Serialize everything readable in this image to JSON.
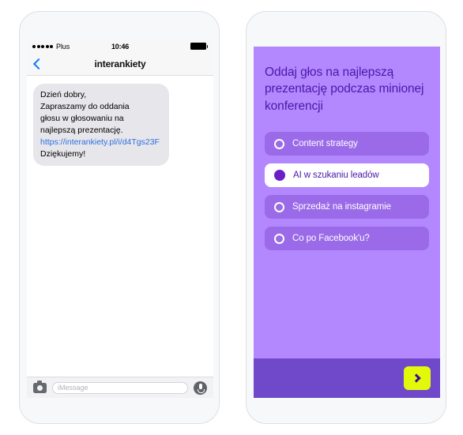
{
  "left_phone": {
    "status_bar": {
      "signal_dots": 5,
      "carrier": "Plus",
      "time": "10:46",
      "battery_icon": "battery-full-icon"
    },
    "nav_bar": {
      "back_icon": "chevron-left-icon",
      "title": "interankiety"
    },
    "message": {
      "line1": "Dzień dobry,",
      "line2": "Zapraszamy do oddania",
      "line3": "głosu w głosowaniu na",
      "line4": "najlepszą prezentację.",
      "link": "https://interankiety.pl/i/d4Tgs23F",
      "line5": "Dziękujemy!"
    },
    "input_bar": {
      "camera_icon": "camera-icon",
      "placeholder": "iMessage",
      "mic_icon": "microphone-icon"
    }
  },
  "right_phone": {
    "poll": {
      "heading": "Oddaj głos na najlepszą prezentację podczas minionej konferencji",
      "options": [
        {
          "label": "Content strategy",
          "selected": false
        },
        {
          "label": "AI w szukaniu leadów",
          "selected": true
        },
        {
          "label": "Sprzedaż na instagramie",
          "selected": false
        },
        {
          "label": "Co po Facebook'u?",
          "selected": false
        }
      ],
      "submit_icon": "chevron-right-icon"
    }
  },
  "colors": {
    "card_background": "#b388ff",
    "option_pill": "#9b6ae8",
    "option_selected_background": "#ffffff",
    "heading_text": "#4b17a8",
    "radio_filled": "#6a1fc7",
    "footer_bar": "#7048ca",
    "submit_button": "#e3f90a",
    "submit_chevron": "#3d0b8e",
    "bubble_background": "#e6e6eb",
    "link_text": "#2f6fe0",
    "back_chevron": "#0b7bff"
  }
}
